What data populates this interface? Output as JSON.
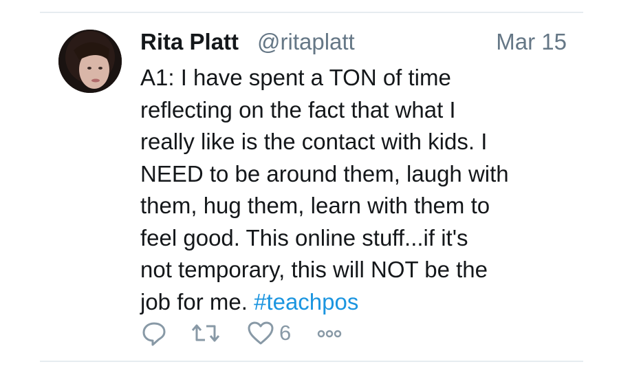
{
  "tweet": {
    "author": {
      "name": "Rita Platt",
      "handle": "@ritaplatt",
      "avatar_icon": "profile-photo"
    },
    "timestamp": "Mar 15",
    "text_lines": [
      "A1: I have spent a TON of time",
      "reflecting on the fact that what I",
      "really like is the contact with kids. I",
      "NEED to be around them, laugh with",
      "them, hug them, learn with them to",
      "feel good. This online stuff...if it's",
      "not temporary, this will NOT be the",
      "job for me."
    ],
    "hashtag": "#teachpos",
    "actions": {
      "reply_icon": "reply-icon",
      "retweet_icon": "retweet-icon",
      "like_icon": "heart-icon",
      "like_count": "6",
      "more_icon": "more-icon"
    },
    "colors": {
      "text": "#14171a",
      "secondary": "#657786",
      "link": "#1b95e0",
      "icon": "#8899a6",
      "divider": "#e6ecf0"
    }
  }
}
